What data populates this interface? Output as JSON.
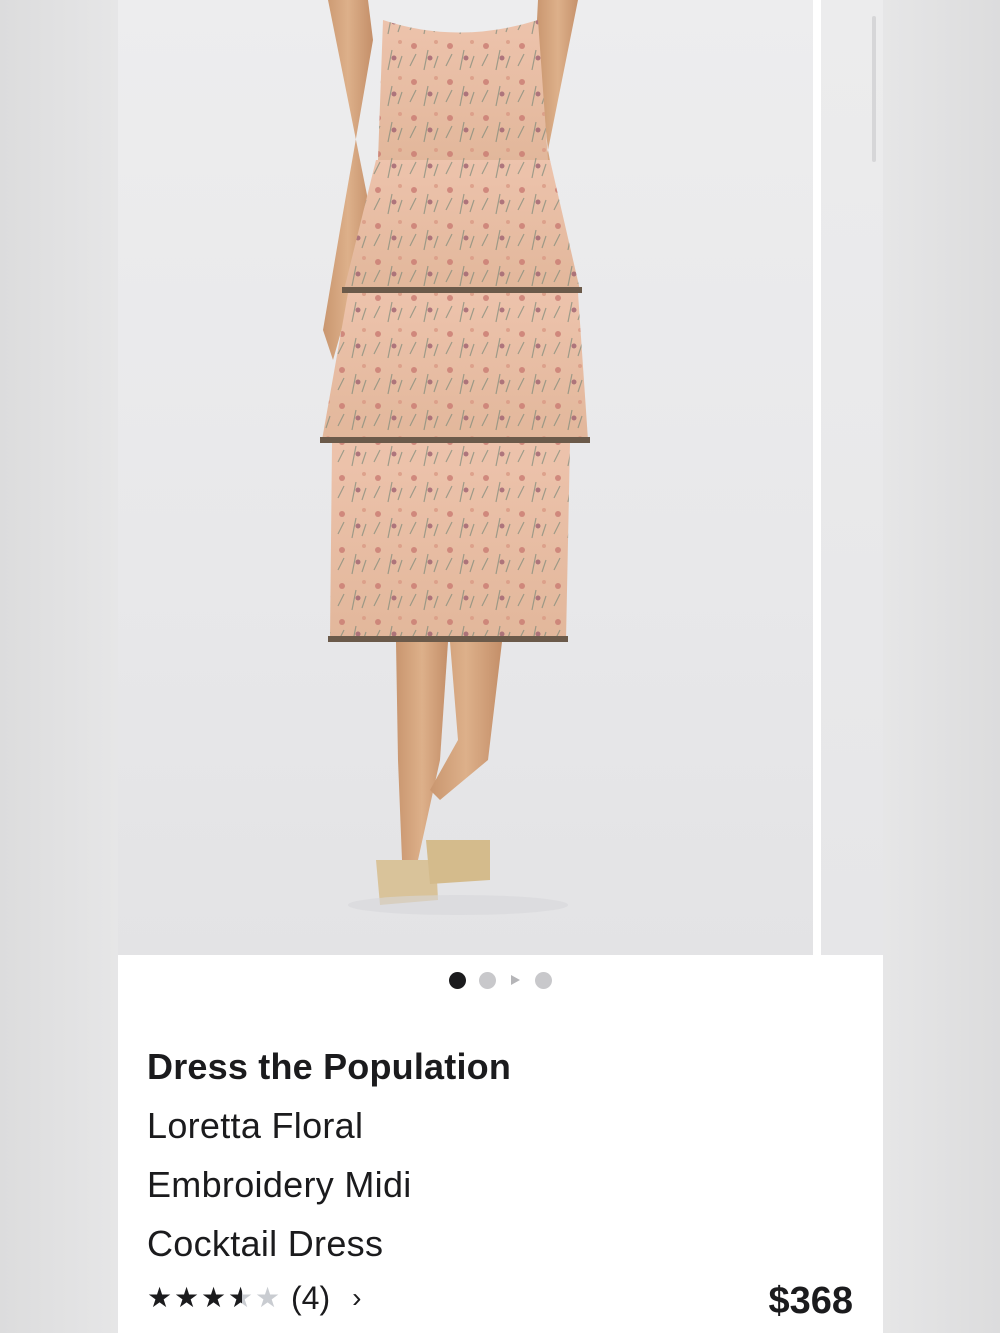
{
  "product": {
    "brand": "Dress the Population",
    "name_lines": [
      "Loretta Floral",
      "Embroidery Midi",
      "Cocktail Dress"
    ],
    "price": "$368",
    "rating": {
      "value": 3.5,
      "max": 5,
      "count_label": "(4)"
    },
    "more_icon": "chevron-right-icon",
    "chevron_glyph": "›"
  },
  "carousel": {
    "current_index": 1,
    "total": 4,
    "has_video": true,
    "image_description": "Model wearing tiered floral-embroidered midi dress with gold strappy sandals"
  },
  "colors": {
    "text": "#1b1b1d",
    "dot_active": "#1b1b1d",
    "dot_inactive": "#c8c8cb",
    "star_empty": "#c9ccd1",
    "background": "#ffffff"
  }
}
